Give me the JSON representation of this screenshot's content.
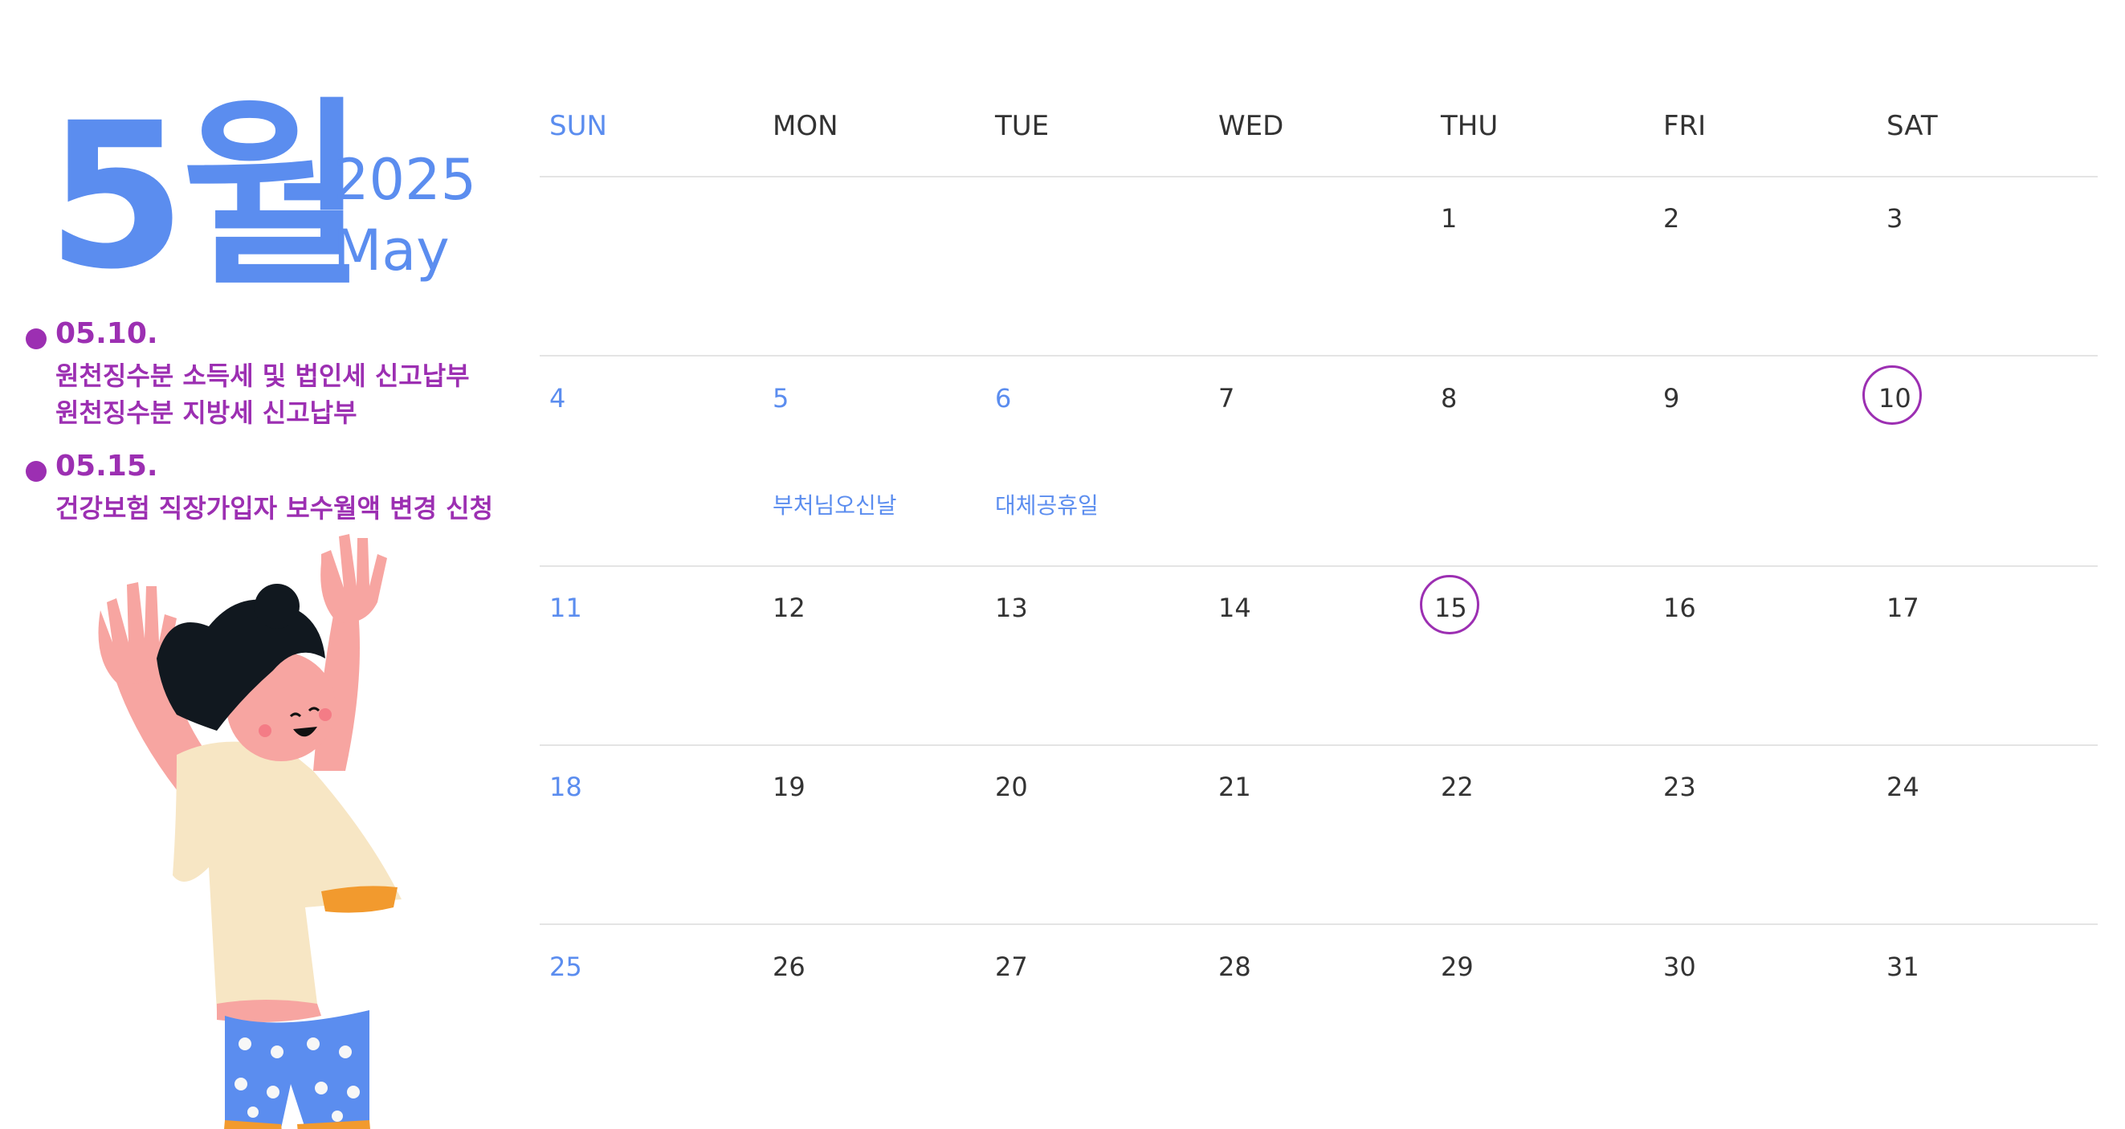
{
  "header": {
    "month_big": "5월",
    "year": "2025",
    "month_en": "May"
  },
  "events": [
    {
      "date": "05.10.",
      "lines": [
        "원천징수분 소득세 및 법인세 신고납부",
        "원천징수분 지방세 신고납부"
      ]
    },
    {
      "date": "05.15.",
      "lines": [
        "건강보험 직장가입자 보수월액 변경 신청"
      ]
    }
  ],
  "calendar": {
    "weekdays": [
      "SUN",
      "MON",
      "TUE",
      "WED",
      "THU",
      "FRI",
      "SAT"
    ],
    "weeks": [
      [
        "",
        "",
        "",
        "",
        "1",
        "2",
        "3"
      ],
      [
        "4",
        "5",
        "6",
        "7",
        "8",
        "9",
        "10"
      ],
      [
        "11",
        "12",
        "13",
        "14",
        "15",
        "16",
        "17"
      ],
      [
        "18",
        "19",
        "20",
        "21",
        "22",
        "23",
        "24"
      ],
      [
        "25",
        "26",
        "27",
        "28",
        "29",
        "30",
        "31"
      ]
    ],
    "holidays": [
      {
        "day": "5",
        "label": "부처님오신날"
      },
      {
        "day": "6",
        "label": "대체공휴일"
      }
    ],
    "circled_days": [
      "10",
      "15"
    ]
  },
  "colors": {
    "accent_blue": "#5b8def",
    "accent_purple": "#9c2fb2",
    "text": "#333333",
    "divider": "#e4e4e4"
  },
  "illustration": "cheering-child-illustration"
}
